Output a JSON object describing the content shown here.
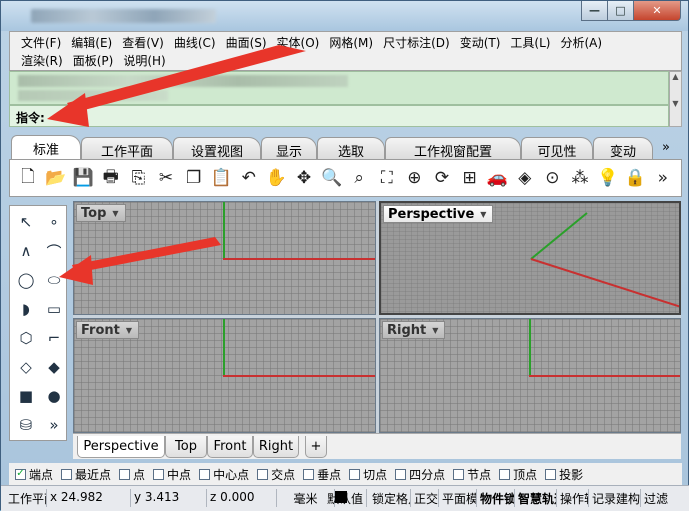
{
  "window": {
    "minimize_glyph": "—",
    "maximize_glyph": "□",
    "close_glyph": "✕"
  },
  "menu": {
    "row1": [
      "文件(F)",
      "编辑(E)",
      "查看(V)",
      "曲线(C)",
      "曲面(S)",
      "实体(O)",
      "网格(M)",
      "尺寸标注(D)",
      "变动(T)",
      "工具(L)",
      "分析(A)"
    ],
    "row2": [
      "渲染(R)",
      "面板(P)",
      "说明(H)"
    ]
  },
  "command": {
    "label": "指令:"
  },
  "tabs": [
    "标准",
    "工作平面",
    "设置视图",
    "显示",
    "选取",
    "工作视窗配置",
    "可见性",
    "变动"
  ],
  "tabs_more": "»",
  "toolbar_icons": [
    "new-file-icon",
    "open-folder-icon",
    "save-icon",
    "print-icon",
    "import-icon",
    "cut-icon",
    "copy-icon",
    "paste-icon",
    "undo-icon",
    "pan-hand-icon",
    "rotate-view-icon",
    "zoom-dynamic-icon",
    "zoom-window-icon",
    "zoom-extents-icon",
    "zoom-selected-icon",
    "rotate-3d-icon",
    "four-viewports-icon",
    "car-render-icon",
    "shade-icon",
    "circle-tool-icon",
    "select-points-icon",
    "light-icon",
    "lock-icon",
    "expand-icon"
  ],
  "side_more": "»",
  "viewports": {
    "top": "Top",
    "perspective": "Perspective",
    "front": "Front",
    "right": "Right"
  },
  "viewport_tabs": [
    "Perspective",
    "Top",
    "Front",
    "Right"
  ],
  "viewport_add": "+",
  "osnaps": [
    {
      "label": "端点",
      "checked": true
    },
    {
      "label": "最近点",
      "checked": false
    },
    {
      "label": "点",
      "checked": false
    },
    {
      "label": "中点",
      "checked": false
    },
    {
      "label": "中心点",
      "checked": false
    },
    {
      "label": "交点",
      "checked": false
    },
    {
      "label": "垂点",
      "checked": false
    },
    {
      "label": "切点",
      "checked": false
    },
    {
      "label": "四分点",
      "checked": false
    },
    {
      "label": "节点",
      "checked": false
    },
    {
      "label": "顶点",
      "checked": false
    },
    {
      "label": "投影",
      "checked": false
    }
  ],
  "status": {
    "cplane": "工作平面",
    "x": "x 24.982",
    "y": "y 3.413",
    "z": "z 0.000",
    "units": "毫米",
    "layer": "默认值",
    "grid_snap": "锁定格点",
    "ortho": "正交",
    "planar": "平面模式",
    "osnap": "物件锁点",
    "smarttrack": "智慧轨迹",
    "gumball": "操作轴",
    "record_history": "记录建构历史",
    "filter": "过滤"
  },
  "colors": {
    "accent_arrow": "#e8352a",
    "axis_x": "#c83030",
    "axis_y": "#2aa02a"
  }
}
